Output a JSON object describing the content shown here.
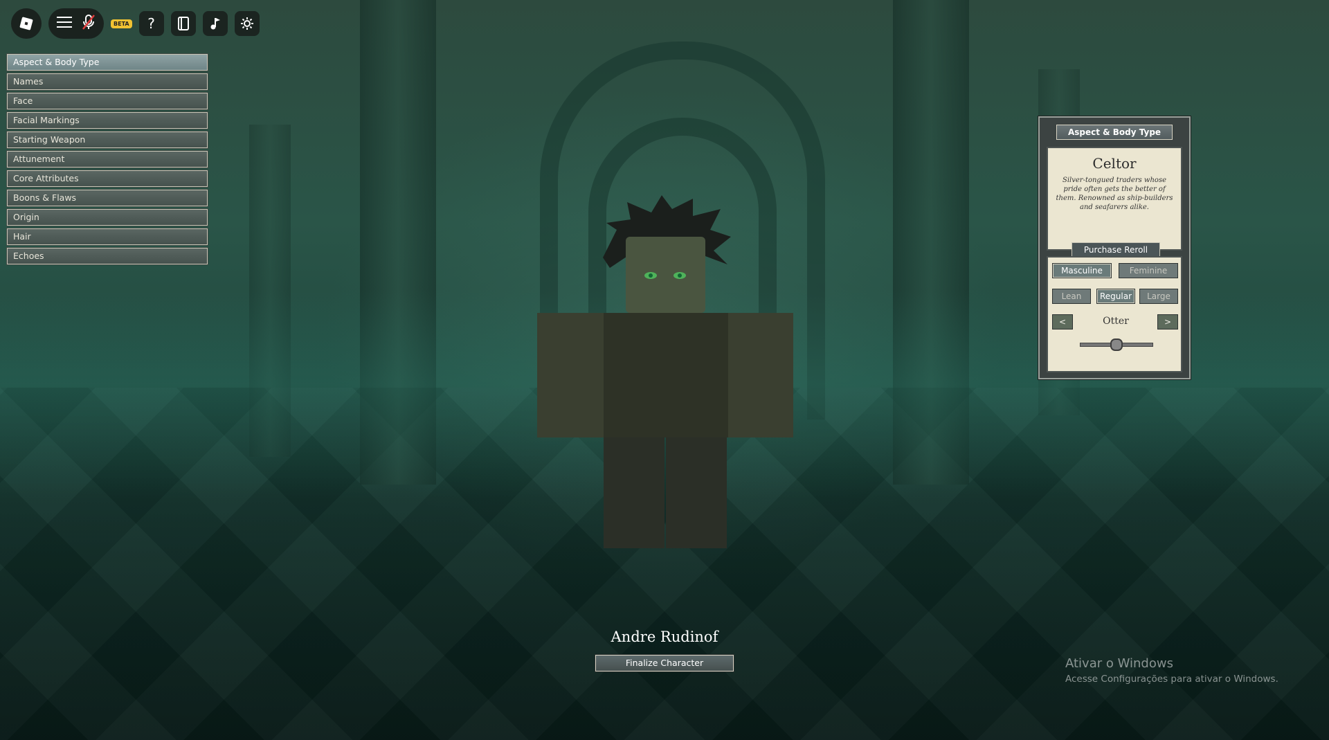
{
  "topbar": {
    "beta_label": "BETA"
  },
  "menu": {
    "items": [
      {
        "label": "Aspect & Body Type",
        "active": true
      },
      {
        "label": "Names"
      },
      {
        "label": "Face"
      },
      {
        "label": "Facial Markings"
      },
      {
        "label": "Starting Weapon"
      },
      {
        "label": "Attunement"
      },
      {
        "label": "Core Attributes"
      },
      {
        "label": "Boons & Flaws"
      },
      {
        "label": "Origin"
      },
      {
        "label": "Hair"
      },
      {
        "label": "Echoes"
      }
    ]
  },
  "panel": {
    "header": "Aspect & Body Type",
    "race_name": "Celtor",
    "race_description": "Silver-tongued traders whose pride often gets the better of them. Renowned as ship-builders and seafarers alike.",
    "reroll_label": "Purchase Reroll",
    "gender": {
      "masculine": "Masculine",
      "feminine": "Feminine",
      "selected": "Masculine"
    },
    "build": {
      "lean": "Lean",
      "regular": "Regular",
      "large": "Large",
      "selected": "Regular"
    },
    "variant": {
      "prev": "<",
      "next": ">",
      "value": "Otter"
    },
    "slider_level": 0.5
  },
  "character": {
    "name": "Andre Rudinof",
    "finalize_label": "Finalize Character"
  },
  "watermark": {
    "title": "Ativar o Windows",
    "subtitle": "Acesse Configurações para ativar o Windows."
  },
  "colors": {
    "menu_active": "#8fa3a5",
    "menu_inactive": "#5a6662",
    "panel_paper": "#ebe6d1",
    "beta": "#f1c232"
  }
}
